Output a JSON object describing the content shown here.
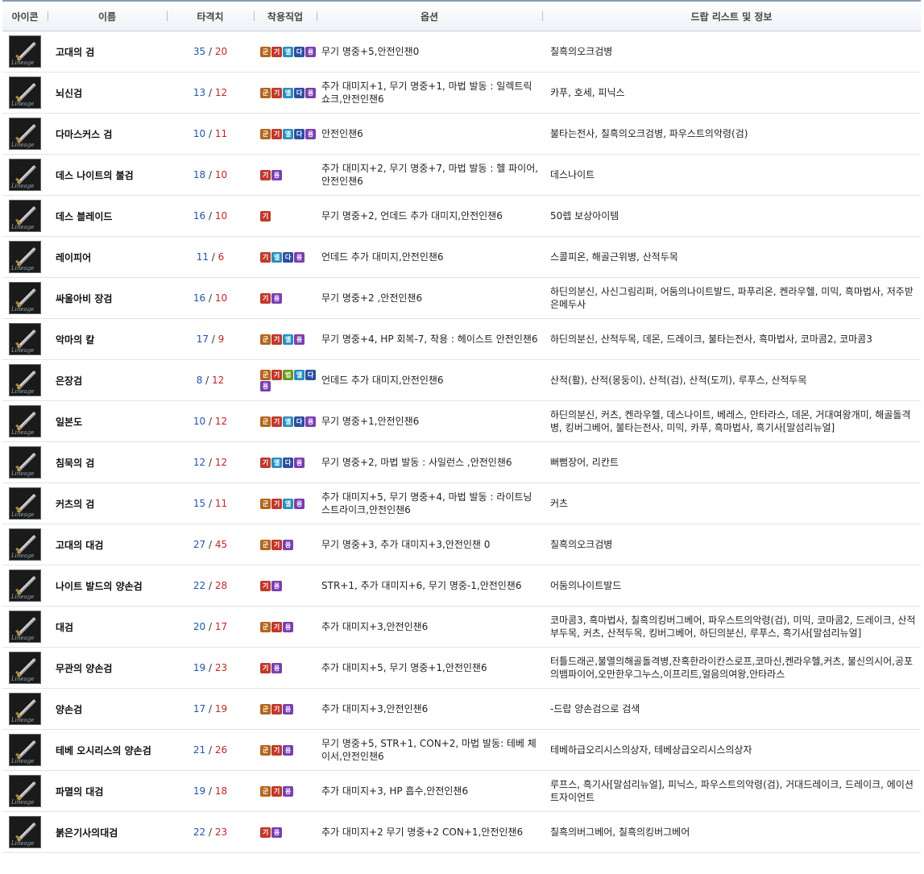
{
  "header": {
    "icon": "아이콘",
    "name": "이름",
    "stat": "타격치",
    "class": "착용직업",
    "option": "옵션",
    "drop": "드랍 리스트 및 정보"
  },
  "class_colors": {
    "군": "#b5651d",
    "기": "#c0392b",
    "엘": "#2a8fbd",
    "다": "#2c4fa0",
    "용": "#7a3fb0",
    "법": "#6a9a1e"
  },
  "items": [
    {
      "name": "고대의 검",
      "small": "35",
      "large": "20",
      "classes": [
        "군",
        "기",
        "엘",
        "다",
        "용"
      ],
      "option": "무기 명중+5,안전인챈0",
      "drop": "칠흑의오크검병",
      "icon": "sword-icon"
    },
    {
      "name": "뇌신검",
      "small": "13",
      "large": "12",
      "classes": [
        "군",
        "기",
        "엘",
        "다",
        "용"
      ],
      "option": "추가 대미지+1, 무기 명중+1, 마법 발동 : 일렉트릭 쇼크,안전인챈6",
      "drop": "카푸, 호세, 피닉스",
      "icon": "sword-icon"
    },
    {
      "name": "다마스커스 검",
      "small": "10",
      "large": "11",
      "classes": [
        "군",
        "기",
        "엘",
        "다",
        "용"
      ],
      "option": "안전인챈6",
      "drop": "불타는전사, 칠흑의오크검병, 파우스트의악령(검)",
      "icon": "sword-icon"
    },
    {
      "name": "데스 나이트의 불검",
      "small": "18",
      "large": "10",
      "classes": [
        "기",
        "용"
      ],
      "option": "추가 대미지+2, 무기 명중+7, 마법 발동 : 헬 파이어,안전인챈6",
      "drop": "데스나이트",
      "icon": "sword-icon"
    },
    {
      "name": "데스 블레이드",
      "small": "16",
      "large": "10",
      "classes": [
        "기"
      ],
      "option": "무기 명중+2, 언데드 추가 대미지,안전인챈6",
      "drop": "50렙 보상아이템",
      "icon": "sword-icon"
    },
    {
      "name": "레이피어",
      "small": "11",
      "large": "6",
      "classes": [
        "기",
        "엘",
        "다",
        "용"
      ],
      "option": "언데드 추가 대미지,안전인챈6",
      "drop": "스콜피온, 해골근위병, 산적두목",
      "icon": "sword-icon"
    },
    {
      "name": "싸울아비 장검",
      "small": "16",
      "large": "10",
      "classes": [
        "기",
        "용"
      ],
      "option": "무기 명중+2 ,안전인챈6",
      "drop": "하딘의분신, 사신그림리퍼, 어둠의나이트발드, 파푸리온, 켄라우헬, 미믹, 흑마법사, 저주받은메두사",
      "icon": "sword-icon"
    },
    {
      "name": "악마의 칼",
      "small": "17",
      "large": "9",
      "classes": [
        "군",
        "기",
        "엘",
        "용"
      ],
      "option": "무기 명중+4, HP 회복-7, 착용 : 헤이스트 안전인챈6",
      "drop": "하딘의분신, 산적두목, 데몬, 드레이크, 불타는전사, 흑마법사, 코마콤2, 코마콤3",
      "icon": "sword-icon"
    },
    {
      "name": "은장검",
      "small": "8",
      "large": "12",
      "classes": [
        "군",
        "기",
        "법",
        "엘",
        "다",
        "용"
      ],
      "option": "언데드 추가 대미지,안전인챈6",
      "drop": "산적(활), 산적(몽둥이), 산적(검), 산적(도끼), 루푸스, 산적두목",
      "icon": "sword-icon"
    },
    {
      "name": "일본도",
      "small": "10",
      "large": "12",
      "classes": [
        "군",
        "기",
        "엘",
        "다",
        "용"
      ],
      "option": "무기 명중+1,안전인챈6",
      "drop": "하딘의분신, 커츠, 켄라우헬, 데스나이트, 베레스, 안타라스, 데몬, 거대여왕개미, 해골돌격병, 킹버그베어, 불타는전사, 미믹, 카푸, 흑마법사, 흑기사[말섬리뉴얼]",
      "icon": "sword-icon"
    },
    {
      "name": "침묵의 검",
      "small": "12",
      "large": "12",
      "classes": [
        "기",
        "엘",
        "다",
        "용"
      ],
      "option": "무기 명중+2, 마법 발동 : 사일런스 ,안전인챈6",
      "drop": "뻐뻠장어, 리칸트",
      "icon": "sword-icon"
    },
    {
      "name": "커츠의 검",
      "small": "15",
      "large": "11",
      "classes": [
        "군",
        "기",
        "엘",
        "용"
      ],
      "option": "추가 대미지+5, 무기 명중+4, 마법 발동 : 라이트닝 스트라이크,안전인챈6",
      "drop": "커츠",
      "icon": "sword-icon"
    },
    {
      "name": "고대의 대검",
      "small": "27",
      "large": "45",
      "classes": [
        "군",
        "기",
        "용"
      ],
      "option": "무기 명중+3, 추가 대미지+3,안전인챈 0",
      "drop": "칠흑의오크검병",
      "icon": "sword-icon"
    },
    {
      "name": "나이트 발드의 양손검",
      "small": "22",
      "large": "28",
      "classes": [
        "기",
        "용"
      ],
      "option": "STR+1, 추가 대미지+6, 무기 명중-1,안전인챈6",
      "drop": "어둠의나이트발드",
      "icon": "sword-icon"
    },
    {
      "name": "대검",
      "small": "20",
      "large": "17",
      "classes": [
        "군",
        "기",
        "용"
      ],
      "option": "추가 대미지+3,안전인챈6",
      "drop": "코마콤3, 흑마법사, 칠흑의킹버그베어, 파우스트의악령(검), 미믹, 코마콤2, 드레이크, 산적부두목, 커츠, 산적두목, 킹버그베어, 하딘의분신, 루푸스, 흑기사[말섬리뉴얼]",
      "icon": "sword-icon"
    },
    {
      "name": "무관의 양손검",
      "small": "19",
      "large": "23",
      "classes": [
        "기",
        "용"
      ],
      "option": "추가 대미지+5, 무기 명중+1,안전인챈6",
      "drop": "터틀드래곤,불멸의해골돌격병,잔혹한라이칸스로프,코마신,켄라우헬,커츠, 불신의시어,공포의뱀파이어,오만한우그누스,이프리트,얼음의여왕,안타라스",
      "icon": "sword-icon"
    },
    {
      "name": "양손검",
      "small": "17",
      "large": "19",
      "classes": [
        "군",
        "기",
        "용"
      ],
      "option": "추가 대미지+3,안전인챈6",
      "drop": "-드랍 양손검으로 검색",
      "icon": "sword-icon"
    },
    {
      "name": "테베 오시리스의 양손검",
      "small": "21",
      "large": "26",
      "classes": [
        "군",
        "기",
        "용"
      ],
      "option": "무기 명중+5, STR+1, CON+2, 마법 발동: 테베 체이서,안전인챈6",
      "drop": "테베하급오리시스의상자, 테베상급오리시스의상자",
      "icon": "sword-icon"
    },
    {
      "name": "파멸의 대검",
      "small": "19",
      "large": "18",
      "classes": [
        "군",
        "기",
        "용"
      ],
      "option": "추가 대미지+3, HP 흡수,안전인챈6",
      "drop": "루프스, 흑기사[말섬리뉴얼], 피닉스, 파우스트의악령(검), 거대드레이크, 드레이크, 에이션트자이언트",
      "icon": "sword-icon"
    },
    {
      "name": "붉은기사의대검",
      "small": "22",
      "large": "23",
      "classes": [
        "기",
        "용"
      ],
      "option": "추가 대미지+2  무기 명중+2  CON+1,안전인챈6",
      "drop": "칠흑의버그베어, 칠흑의킹버그베어",
      "icon": "sword-icon"
    }
  ],
  "watermark": "Lineage"
}
